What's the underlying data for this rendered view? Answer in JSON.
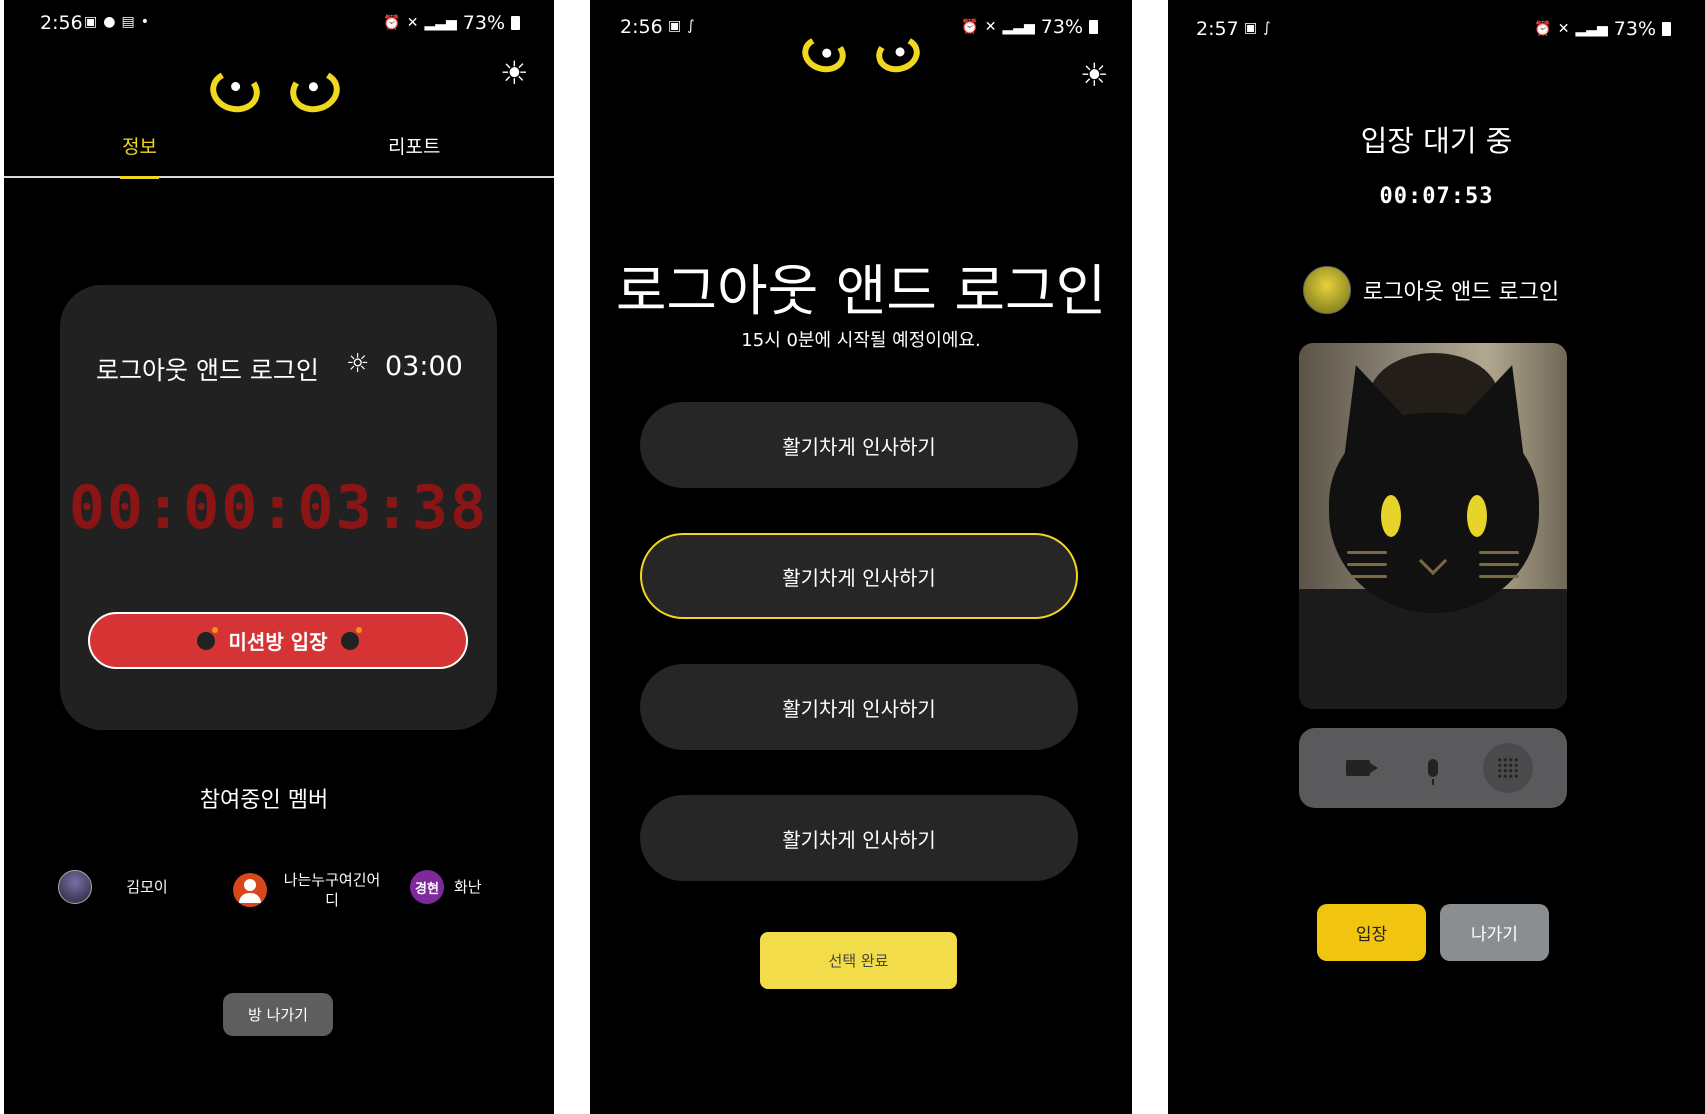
{
  "screen1": {
    "status": {
      "time": "2:56",
      "battery": "73%"
    },
    "tabs": [
      {
        "label": "정보"
      },
      {
        "label": "리포트"
      }
    ],
    "card": {
      "room_title": "로그아웃 앤드 로그인",
      "time": "03:00",
      "timer": "00:00:03:38",
      "mission_button": "미션방 입장"
    },
    "members_title": "참여중인 멤버",
    "members": [
      {
        "name": "김모이"
      },
      {
        "name": "나는누구여긴어\n디"
      },
      {
        "avatar_text": "경현",
        "name": "화난"
      }
    ],
    "leave_button": "방 나가기"
  },
  "screen2": {
    "status": {
      "time": "2:56",
      "battery": "73%"
    },
    "title": "로그아웃 앤드 로그인",
    "subtitle": "15시 0분에 시작될 예정이에요.",
    "options": [
      {
        "label": "활기차게 인사하기",
        "selected": false
      },
      {
        "label": "활기차게 인사하기",
        "selected": true
      },
      {
        "label": "활기차게 인사하기",
        "selected": false
      },
      {
        "label": "활기차게 인사하기",
        "selected": false
      }
    ],
    "confirm_button": "선택 완료"
  },
  "screen3": {
    "status": {
      "time": "2:57",
      "battery": "73%"
    },
    "title": "입장 대기 중",
    "timer": "00:07:53",
    "user_name": "로그아웃 앤드 로그인",
    "enter_button": "입장",
    "leave_button": "나가기"
  },
  "colors": {
    "accent_yellow": "#f1d820",
    "mission_red": "#d63434",
    "timer_red": "#8b1515"
  }
}
